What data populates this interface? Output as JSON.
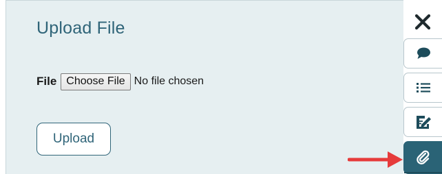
{
  "panel": {
    "title": "Upload File",
    "file_label": "File",
    "choose_button_label": "Choose File",
    "no_file_text": "No file chosen",
    "upload_button_label": "Upload"
  },
  "sidebar": {
    "items": [
      {
        "name": "close",
        "icon": "close-icon"
      },
      {
        "name": "comments",
        "icon": "speech-bubble-icon"
      },
      {
        "name": "list",
        "icon": "list-icon"
      },
      {
        "name": "edit",
        "icon": "edit-document-icon"
      },
      {
        "name": "attachments",
        "icon": "paperclip-icon",
        "active": true
      }
    ]
  },
  "annotation": {
    "arrow_color": "#e63b3b",
    "arrow_target": "attachments"
  },
  "colors": {
    "accent": "#2f6478",
    "panel_bg": "#e6eff1",
    "active_tab": "#2a6376"
  }
}
